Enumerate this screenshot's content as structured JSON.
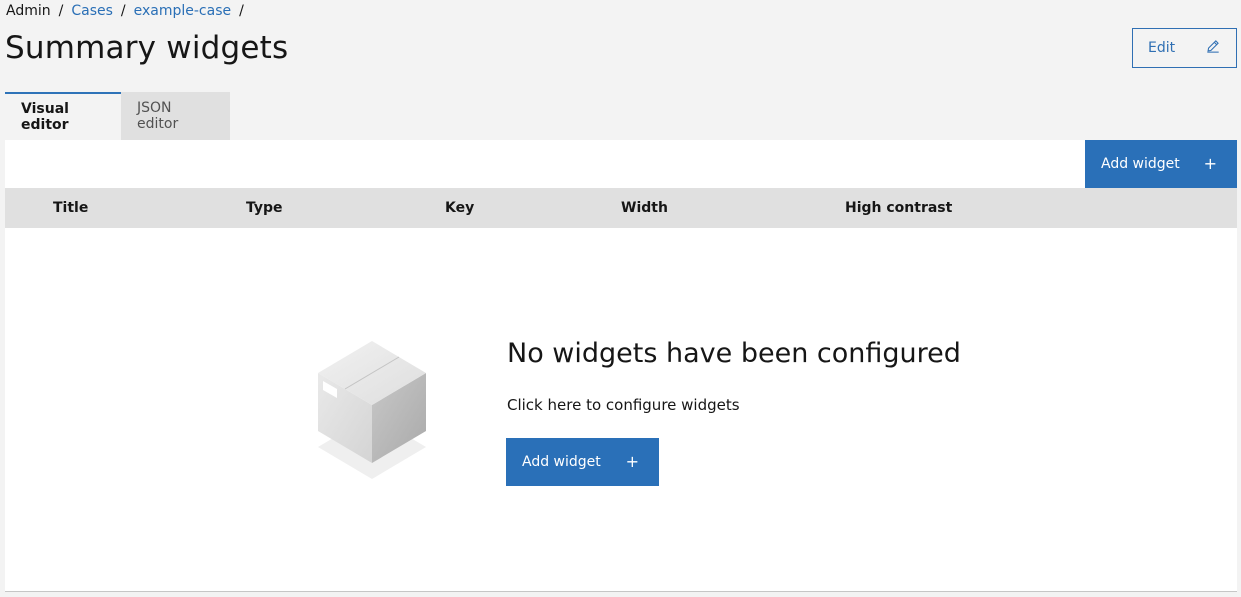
{
  "breadcrumb": {
    "items": [
      {
        "label": "Admin",
        "link": false
      },
      {
        "label": "Cases",
        "link": true
      },
      {
        "label": "example-case",
        "link": true
      }
    ],
    "separator": "/"
  },
  "header": {
    "title": "Summary widgets",
    "edit_label": "Edit",
    "edit_icon": "pencil-icon"
  },
  "tabs": [
    {
      "label": "Visual editor",
      "active": true
    },
    {
      "label": "JSON editor",
      "active": false
    }
  ],
  "toolbar": {
    "add_label": "Add widget",
    "add_icon": "+"
  },
  "table": {
    "columns": [
      "Title",
      "Type",
      "Key",
      "Width",
      "High contrast"
    ]
  },
  "empty_state": {
    "title": "No widgets have been configured",
    "subtitle": "Click here to configure widgets",
    "button_label": "Add widget",
    "button_icon": "+",
    "illustration": "box-icon"
  },
  "colors": {
    "accent": "#2a70b8",
    "link": "#2a6fb6",
    "background": "#f3f3f3",
    "header_row": "#e0e0e0"
  }
}
